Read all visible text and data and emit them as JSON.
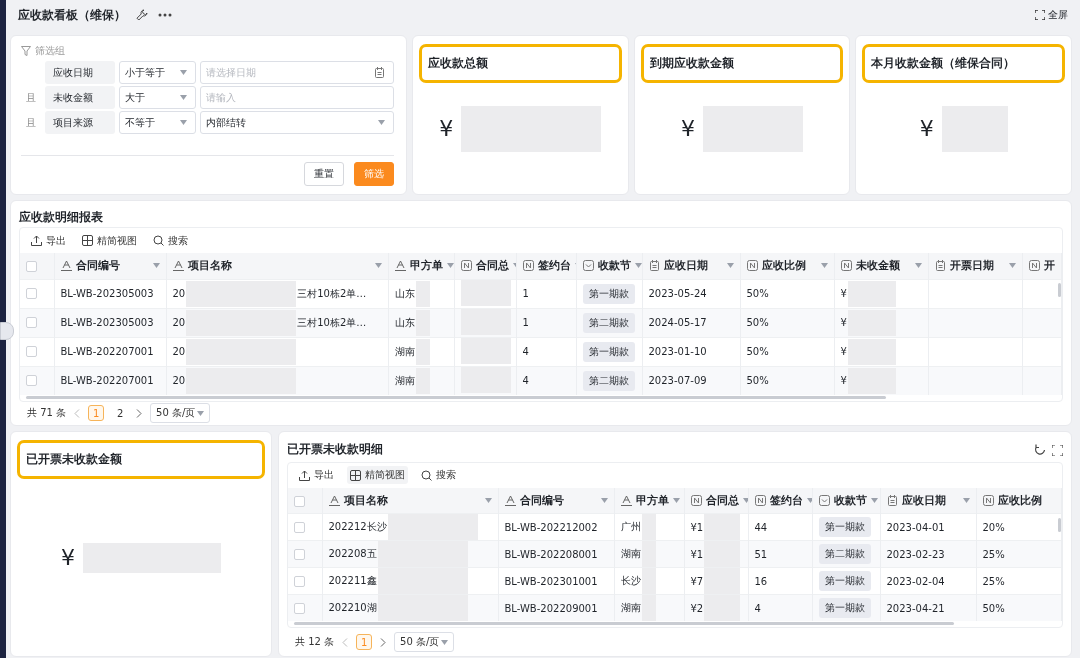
{
  "header": {
    "title": "应收款看板（维保）",
    "fullscreen": "全屏"
  },
  "filter": {
    "title": "筛选组",
    "rows": [
      {
        "field": "应收日期",
        "operator": "小于等于",
        "kind": "date",
        "placeholder": "请选择日期"
      },
      {
        "connector": "且",
        "field": "未收金额",
        "operator": "大于",
        "kind": "input",
        "placeholder": "请输入"
      },
      {
        "connector": "且",
        "field": "项目来源",
        "operator": "不等于",
        "kind": "select",
        "value": "内部结转"
      }
    ],
    "buttons": [
      {
        "label": "重置",
        "kind": "default"
      },
      {
        "label": "筛选",
        "kind": "primary"
      }
    ]
  },
  "metrics": [
    {
      "title": "应收款总额",
      "currency": "¥",
      "highlighted": true,
      "redacted": true
    },
    {
      "title": "到期应收款金额",
      "currency": "¥",
      "highlighted": true,
      "redacted": true
    },
    {
      "title": "本月收款金额（维保合同）",
      "currency": "¥",
      "highlighted": true,
      "redacted": true
    }
  ],
  "report": {
    "title": "应收款明细报表",
    "toolbar": [
      "导出",
      "精简视图",
      "搜索"
    ],
    "all_checked": false,
    "columns": [
      {
        "label": "合同编号",
        "kind": "text"
      },
      {
        "label": "项目名称",
        "kind": "text"
      },
      {
        "label": "甲方单",
        "kind": "text"
      },
      {
        "label": "合同总",
        "kind": "number"
      },
      {
        "label": "签约台",
        "kind": "number"
      },
      {
        "label": "收款节",
        "kind": "select"
      },
      {
        "label": "应收日期",
        "kind": "date"
      },
      {
        "label": "应收比例",
        "kind": "number"
      },
      {
        "label": "未收金额",
        "kind": "number"
      },
      {
        "label": "开票日期",
        "kind": "date"
      },
      {
        "label": "开",
        "kind": "number"
      }
    ],
    "rows": [
      {
        "checked": false,
        "cells": [
          "BL-WB-202305003",
          {
            "text": "20",
            "redacted": true,
            "tail": "三村10栋2单…"
          },
          {
            "text": "山东",
            "redacted": true
          },
          {
            "redacted": true
          },
          "1",
          "第一期款",
          "2023-05-24",
          "50%",
          {
            "text": "¥",
            "redacted": true
          },
          null,
          null
        ]
      },
      {
        "checked": false,
        "cells": [
          "BL-WB-202305003",
          {
            "text": "20",
            "redacted": true,
            "tail": "三村10栋2单…"
          },
          {
            "text": "山东",
            "redacted": true
          },
          {
            "redacted": true
          },
          "1",
          "第二期款",
          "2024-05-17",
          "50%",
          {
            "text": "¥",
            "redacted": true
          },
          null,
          null
        ]
      },
      {
        "checked": false,
        "cells": [
          "BL-WB-202207001",
          {
            "text": "20",
            "redacted": true
          },
          {
            "text": "湖南",
            "redacted": true
          },
          {
            "redacted": true
          },
          "4",
          "第一期款",
          "2023-01-10",
          "50%",
          {
            "text": "¥",
            "redacted": true
          },
          null,
          null
        ]
      },
      {
        "checked": false,
        "cells": [
          "BL-WB-202207001",
          {
            "text": "20",
            "redacted": true
          },
          {
            "text": "湖南",
            "redacted": true
          },
          {
            "redacted": true
          },
          "4",
          "第二期款",
          "2023-07-09",
          "50%",
          {
            "text": "¥",
            "redacted": true
          },
          null,
          null
        ]
      }
    ],
    "pager": {
      "total": "共 71 条",
      "pages": [
        {
          "label": "1",
          "selected": true
        },
        {
          "label": "2",
          "selected": false
        }
      ],
      "size": "50 条/页"
    }
  },
  "invoiced_amount": {
    "title": "已开票未收款金额",
    "currency": "¥",
    "highlighted": true,
    "redacted": true
  },
  "invoiced_detail": {
    "title": "已开票未收款明细",
    "toolbar": [
      "导出",
      "精简视图",
      "搜索"
    ],
    "all_checked": false,
    "columns": [
      {
        "label": "项目名称",
        "kind": "text"
      },
      {
        "label": "合同编号",
        "kind": "text"
      },
      {
        "label": "甲方单",
        "kind": "text"
      },
      {
        "label": "合同总",
        "kind": "number"
      },
      {
        "label": "签约台",
        "kind": "number"
      },
      {
        "label": "收款节",
        "kind": "select"
      },
      {
        "label": "应收日期",
        "kind": "date"
      },
      {
        "label": "应收比例",
        "kind": "number"
      }
    ],
    "rows": [
      {
        "checked": false,
        "cells": [
          {
            "text": "202212长沙",
            "redacted": true
          },
          "BL-WB-202212002",
          {
            "text": "广州",
            "redacted": true
          },
          {
            "text": "¥1",
            "redacted": true
          },
          "44",
          "第一期款",
          "2023-04-01",
          "20%"
        ]
      },
      {
        "checked": false,
        "cells": [
          {
            "text": "202208五",
            "redacted": true
          },
          "BL-WB-202208001",
          {
            "text": "湖南",
            "redacted": true
          },
          {
            "text": "¥1",
            "redacted": true
          },
          "51",
          "第二期款",
          "2023-02-23",
          "25%"
        ]
      },
      {
        "checked": false,
        "cells": [
          {
            "text": "202211鑫",
            "redacted": true
          },
          "BL-WB-202301001",
          {
            "text": "长沙",
            "redacted": true
          },
          {
            "text": "¥7",
            "redacted": true
          },
          "16",
          "第一期款",
          "2023-02-04",
          "25%"
        ]
      },
      {
        "checked": false,
        "cells": [
          {
            "text": "202210湖",
            "redacted": true
          },
          "BL-WB-202209001",
          {
            "text": "湖南",
            "redacted": true
          },
          {
            "text": "¥2",
            "redacted": true
          },
          "4",
          "第一期款",
          "2023-04-21",
          "50%"
        ]
      }
    ],
    "pager": {
      "total": "共 12 条",
      "pages": [
        {
          "label": "1",
          "selected": true
        }
      ],
      "size": "50 条/页"
    }
  }
}
